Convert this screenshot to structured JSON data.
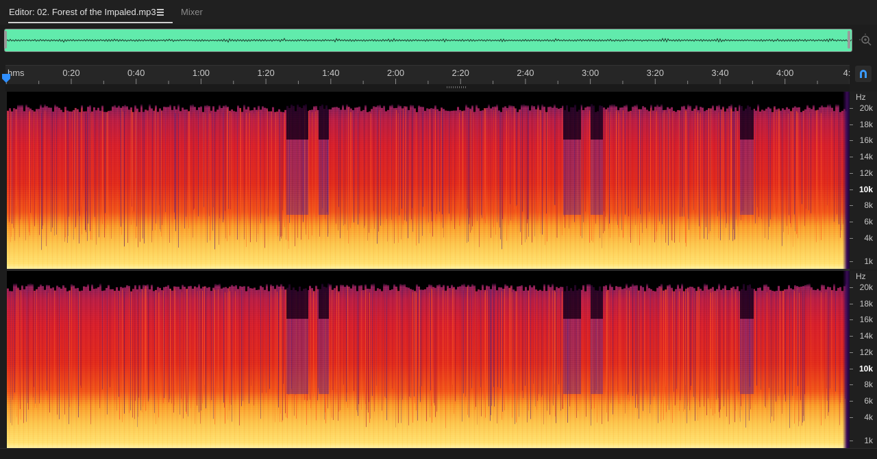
{
  "editor": {
    "tab_label": "Editor: 02. Forest of the Impaled.mp3",
    "mixer_label": "Mixer"
  },
  "colors": {
    "overview_wave": "#61ebac",
    "spectrogram_high": "#ffe070",
    "spectrogram_mid": "#e02a1c",
    "spectrogram_top": "#8a1f58",
    "playhead": "#2f8fff"
  },
  "timeline": {
    "unit": "hms",
    "labels": [
      "0:20",
      "0:40",
      "1:00",
      "1:20",
      "1:40",
      "2:00",
      "2:20",
      "2:40",
      "3:00",
      "3:20",
      "3:40",
      "4:00",
      "4:"
    ]
  },
  "frequency_scale": {
    "unit": "Hz",
    "labels": [
      "20k",
      "18k",
      "16k",
      "14k",
      "12k",
      "10k",
      "8k",
      "6k",
      "4k",
      "1k"
    ]
  },
  "icons": {
    "tab_menu": "hamburger-icon",
    "zoom": "zoom-in-icon",
    "snap": "magnet-icon",
    "playhead": "playhead-marker-icon"
  }
}
